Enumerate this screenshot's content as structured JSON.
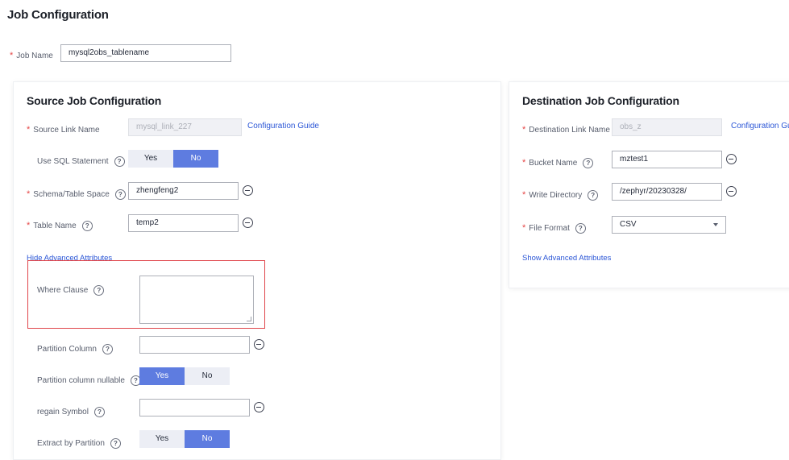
{
  "page": {
    "title": "Job Configuration"
  },
  "job": {
    "label": "Job Name",
    "value": "mysql2obs_tablename"
  },
  "source": {
    "title": "Source Job Configuration",
    "link_name_label": "Source Link Name",
    "link_name_value": "mysql_link_227",
    "config_guide": "Configuration Guide",
    "use_sql_label": "Use SQL Statement",
    "use_sql_yes": "Yes",
    "use_sql_no": "No",
    "schema_label": "Schema/Table Space",
    "schema_value": "zhengfeng2",
    "table_label": "Table Name",
    "table_value": "temp2",
    "hide_adv": "Hide Advanced Attributes",
    "where_label": "Where Clause",
    "where_value": "",
    "partition_col_label": "Partition Column",
    "partition_col_value": "",
    "partition_nullable_label": "Partition column nullable",
    "partition_nullable_yes": "Yes",
    "partition_nullable_no": "No",
    "regain_label": "regain Symbol",
    "regain_value": "",
    "extract_label": "Extract by Partition",
    "extract_yes": "Yes",
    "extract_no": "No"
  },
  "destination": {
    "title": "Destination Job Configuration",
    "link_name_label": "Destination Link Name",
    "link_name_value": "obs_z",
    "config_guide": "Configuration Guid",
    "bucket_label": "Bucket Name",
    "bucket_value": "mztest1",
    "write_dir_label": "Write Directory",
    "write_dir_value": "/zephyr/20230328/",
    "file_format_label": "File Format",
    "file_format_value": "CSV",
    "show_adv": "Show Advanced Attributes"
  },
  "colors": {
    "accent": "#5e7ce0",
    "link": "#2b56d6",
    "required": "#e54545",
    "highlight": "#e0454b"
  }
}
